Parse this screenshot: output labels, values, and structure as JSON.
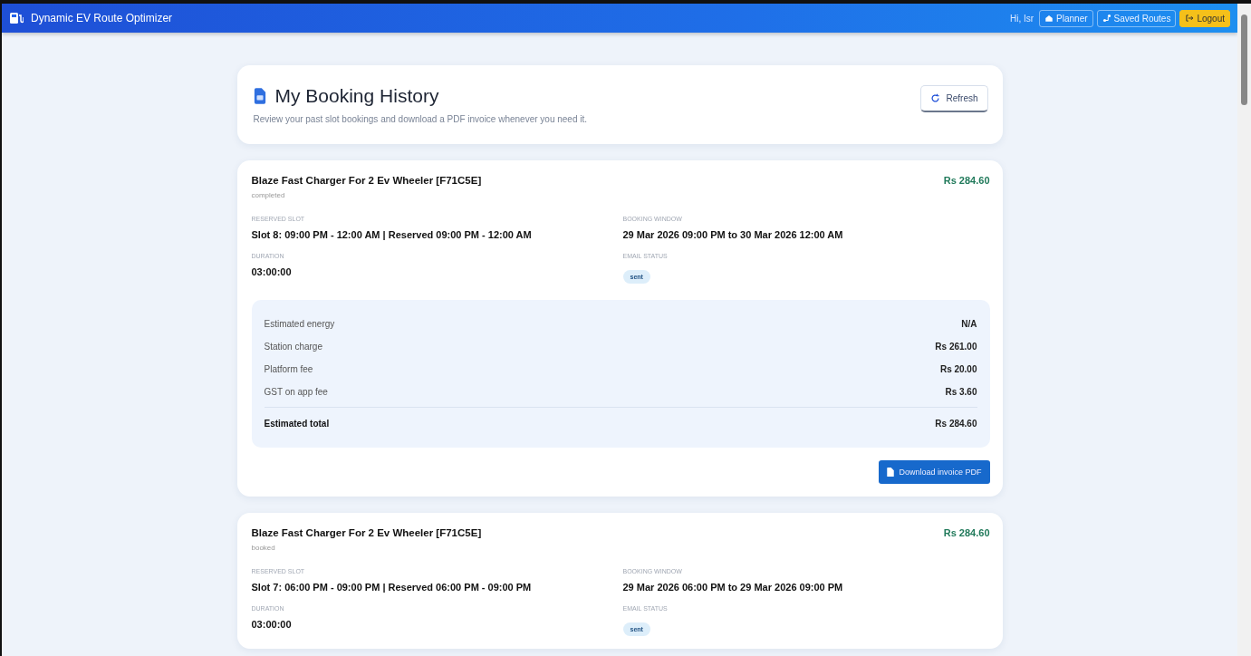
{
  "app": {
    "title": "Dynamic EV Route Optimizer"
  },
  "nav": [
    {
      "kind": "text",
      "label": "Hi, Isr"
    },
    {
      "kind": "link",
      "label": "Planner"
    },
    {
      "kind": "link",
      "label": "Saved Routes"
    },
    {
      "kind": "logout",
      "label": "Logout"
    }
  ],
  "header": {
    "title": "My Booking History",
    "subtitle": "Review your past slot bookings and download a PDF invoice whenever you need it.",
    "refresh": "Refresh"
  },
  "bookings": [
    {
      "station": "Blaze Fast Charger For 2 Ev Wheeler [F71C5E]",
      "status": "completed",
      "amount": "Rs 284.60",
      "fields": [
        {
          "label": "RESERVED SLOT",
          "value": "Slot 8: 09:00 PM - 12:00 AM | Reserved 09:00 PM - 12:00 AM"
        },
        {
          "label": "BOOKING WINDOW",
          "value": "29 Mar 2026 09:00 PM to 30 Mar 2026 12:00 AM"
        },
        {
          "label": "DURATION",
          "value": "03:00:00"
        },
        {
          "label": "EMAIL STATUS",
          "badge": "sent"
        }
      ],
      "charges": [
        {
          "label": "Estimated energy",
          "value": "N/A",
          "total": false
        },
        {
          "label": "Station charge",
          "value": "Rs 261.00",
          "total": false
        },
        {
          "label": "Platform fee",
          "value": "Rs 20.00",
          "total": false
        },
        {
          "label": "GST on app fee",
          "value": "Rs 3.60",
          "total": false
        },
        {
          "label": "Estimated total",
          "value": "Rs 284.60",
          "total": true
        }
      ],
      "download": "Download invoice PDF"
    },
    {
      "station": "Blaze Fast Charger For 2 Ev Wheeler [F71C5E]",
      "status": "booked",
      "amount": "Rs 284.60",
      "fields": [
        {
          "label": "RESERVED SLOT",
          "value": "Slot 7: 06:00 PM - 09:00 PM | Reserved 06:00 PM - 09:00 PM"
        },
        {
          "label": "BOOKING WINDOW",
          "value": "29 Mar 2026 06:00 PM to 29 Mar 2026 09:00 PM"
        },
        {
          "label": "DURATION",
          "value": "03:00:00"
        },
        {
          "label": "EMAIL STATUS",
          "badge": "sent"
        }
      ]
    }
  ]
}
